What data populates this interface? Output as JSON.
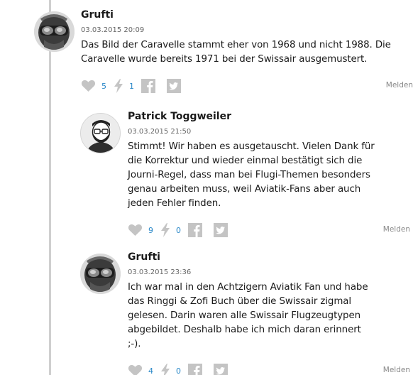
{
  "comments": [
    {
      "author": "Grufti",
      "date": "03.03.2015 20:09",
      "text": "Das Bild der Caravelle stammt eher von 1968 und nicht 1988. Die Caravelle wurde bereits 1971 bei der Swissair ausgemustert.",
      "likes": "5",
      "boosts": "1",
      "report": "Melden",
      "avatar": "biker-goggles-avatar"
    },
    {
      "author": "Patrick Toggweiler",
      "date": "03.03.2015 21:50",
      "text": "Stimmt! Wir haben es ausgetauscht. Vielen Dank für die Korrektur und wieder einmal bestätigt sich die Journi-Regel, dass man bei Flugi-Themen besonders genau arbeiten muss, weil Aviatik-Fans aber auch jeden Fehler finden.",
      "likes": "9",
      "boosts": "0",
      "report": "Melden",
      "avatar": "bearded-man-illustration-avatar"
    },
    {
      "author": "Grufti",
      "date": "03.03.2015 23:36",
      "text": "Ich war mal in den Achtzigern Aviatik Fan und habe das Ringgi & Zofi Buch über die Swissair zigmal gelesen. Darin waren alle Swissair Flugzeugtypen abgebildet. Deshalb habe ich mich daran erinnert ;-).",
      "likes": "4",
      "boosts": "0",
      "report": "Melden",
      "avatar": "biker-goggles-avatar"
    }
  ],
  "icons": {
    "like": "heart-icon",
    "boost": "lightning-icon",
    "facebook": "facebook-icon",
    "twitter": "twitter-icon"
  },
  "colors": {
    "count": "#2a88c8",
    "icon": "#c4c4c4",
    "thread_line": "#cfcfcf"
  }
}
